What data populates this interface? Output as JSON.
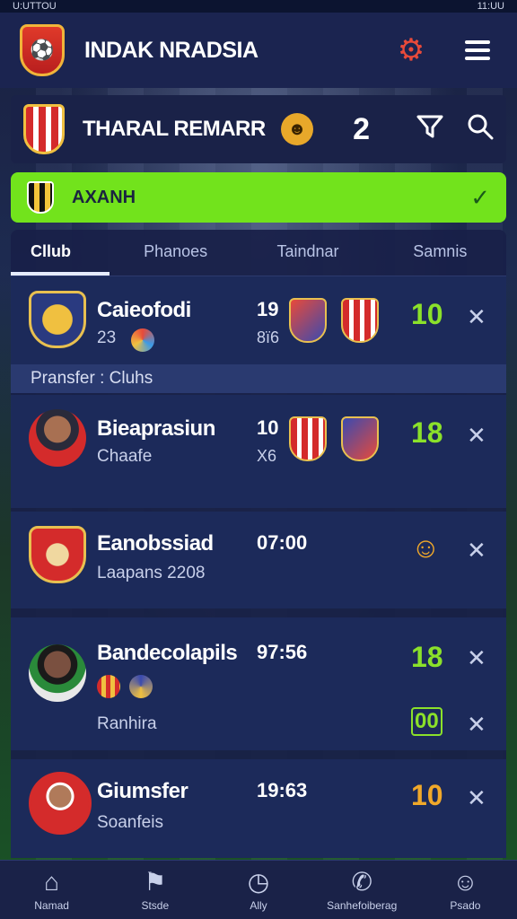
{
  "status_bar": {
    "left": "U:UTTOU",
    "right": "11:UU"
  },
  "header": {
    "title": "INDAK NRADSIA",
    "crest_icon": "club-crest",
    "settings_icon": "gear-icon",
    "menu_icon": "hamburger-icon"
  },
  "team_bar": {
    "name": "THARAL REMARR",
    "coin": "☻",
    "count": "2"
  },
  "banner": {
    "label": "AXANH",
    "check": "✓",
    "color": "#72e31c"
  },
  "tabs": [
    "Cllub",
    "Phanoes",
    "Taindnar",
    "Samnis"
  ],
  "section_label": "Pransfer : Cluhs",
  "rows": [
    {
      "title": "Caieofodi",
      "sub": "23",
      "num": "19",
      "num2": "8ï6",
      "score": "10",
      "score_color": "#8be12a",
      "x": "✕"
    },
    {
      "title": "Bieaprasiun",
      "sub": "Chaafe",
      "num": "10",
      "num2": "X6",
      "score": "18",
      "score_color": "#8be12a",
      "x": "✕"
    },
    {
      "title": "Eanobssiad",
      "sub": "Laapans 2208",
      "num": "07:00",
      "score": "☺",
      "score_color": "#f0a82a",
      "x": "✕"
    },
    {
      "title": "Bandecolapils",
      "sub": "Ranhira",
      "num": "97:56",
      "score": "18",
      "score_color": "#8be12a",
      "score2": "00",
      "x": "✕"
    },
    {
      "title": "Giumsfer",
      "sub": "Soanfeis",
      "num": "19:63",
      "score": "10",
      "score_color": "#f0a82a",
      "x": "✕"
    }
  ],
  "nav": [
    {
      "label": "Namad",
      "icon": "⌂"
    },
    {
      "label": "Stsde",
      "icon": "⚑"
    },
    {
      "label": "Ally",
      "icon": "◷"
    },
    {
      "label": "Sanhefoiberag",
      "icon": "✆"
    },
    {
      "label": "Psado",
      "icon": "☺"
    }
  ]
}
